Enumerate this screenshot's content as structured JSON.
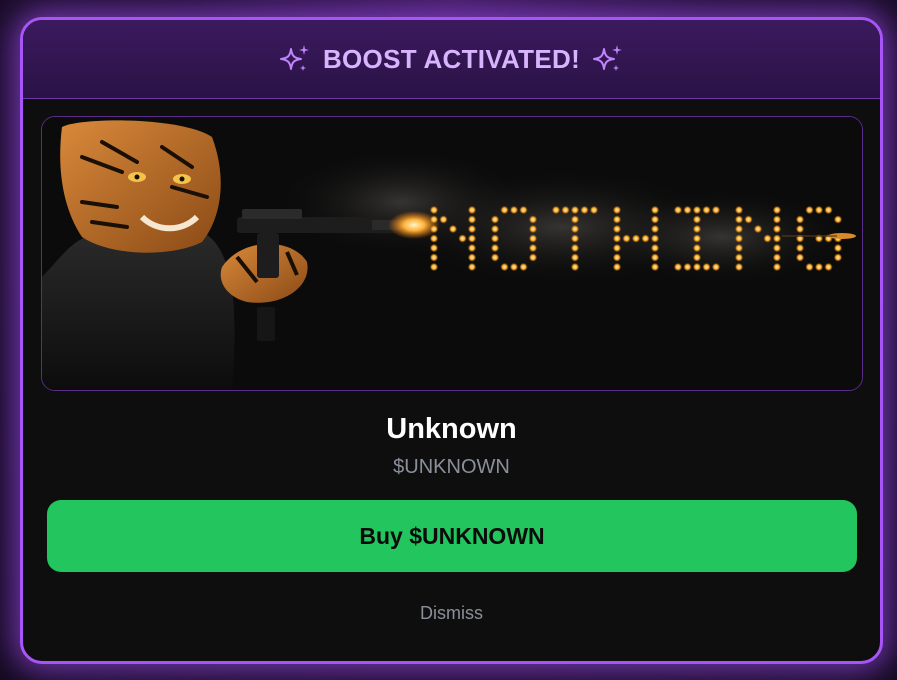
{
  "header": {
    "title": "BOOST ACTIVATED!",
    "left_icon": "sparkles-icon",
    "right_icon": "sparkles-icon",
    "accent_color": "#d8b4fe"
  },
  "banner": {
    "image_description_icon": "tiger-shooting-banner-image",
    "banner_text": "NOTHING"
  },
  "token": {
    "name": "Unknown",
    "symbol": "$UNKNOWN"
  },
  "actions": {
    "buy_label": "Buy $UNKNOWN",
    "buy_color": "#22c55e",
    "dismiss_label": "Dismiss"
  },
  "theme": {
    "border_color": "#a855f7",
    "background": "#0e0e0f"
  }
}
